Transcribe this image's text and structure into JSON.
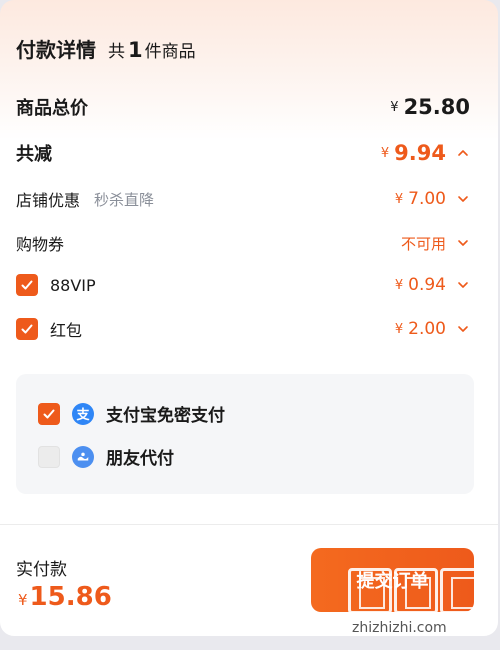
{
  "header": {
    "title": "付款详情",
    "count_prefix": "共",
    "count_num": "1",
    "count_suffix": "件商品"
  },
  "total_price": {
    "label": "商品总价",
    "currency": "¥",
    "amount": "25.80"
  },
  "discount": {
    "label": "共减",
    "currency": "¥",
    "amount": "9.94"
  },
  "store_discount": {
    "label": "店铺优惠",
    "sub": "秒杀直降",
    "currency": "¥",
    "amount": "7.00"
  },
  "coupon": {
    "label": "购物券",
    "status": "不可用"
  },
  "vip": {
    "label": "88VIP",
    "currency": "¥",
    "amount": "0.94",
    "checked": true
  },
  "red_packet": {
    "label": "红包",
    "currency": "¥",
    "amount": "2.00",
    "checked": true
  },
  "payment": {
    "options": [
      {
        "label": "支付宝免密支付",
        "icon": "alipay-icon",
        "checked": true
      },
      {
        "label": "朋友代付",
        "icon": "friend-pay-icon",
        "checked": false
      }
    ]
  },
  "footer": {
    "label": "实付款",
    "currency": "¥",
    "amount": "15.86",
    "submit_label": "提交订单"
  },
  "watermark": {
    "text": "zhizhizhi.com"
  },
  "colors": {
    "accent": "#ee5a1b",
    "alipay": "#2f86f6"
  }
}
